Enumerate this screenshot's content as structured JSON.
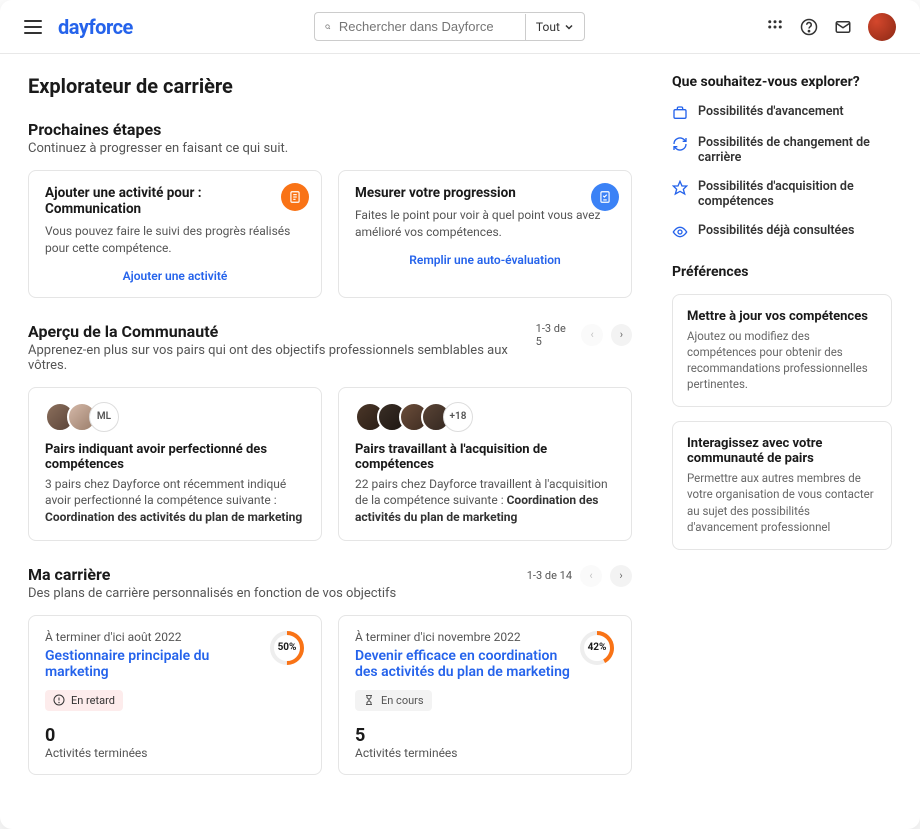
{
  "header": {
    "logo": "dayforce",
    "search_placeholder": "Rechercher dans Dayforce",
    "search_filter": "Tout"
  },
  "page_title": "Explorateur de carrière",
  "next_steps": {
    "heading": "Prochaines étapes",
    "subtitle": "Continuez à progresser en faisant ce qui suit.",
    "cards": [
      {
        "title": "Ajouter une activité pour : Communication",
        "desc": "Vous pouvez faire le suivi des progrès réalisés pour cette compétence.",
        "link": "Ajouter une activité"
      },
      {
        "title": "Mesurer votre progression",
        "desc": "Faites le point pour voir à quel point vous avez amélioré vos compétences.",
        "link": "Remplir une auto-évaluation"
      }
    ]
  },
  "community": {
    "heading": "Aperçu de la Communauté",
    "subtitle": "Apprenez-en plus sur vos pairs qui ont des objectifs professionnels semblables aux vôtres.",
    "pager": "1-3 de 5",
    "cards": [
      {
        "extra_label": "ML",
        "title": "Pairs indiquant avoir perfectionné des compétences",
        "desc_prefix": "3 pairs chez Dayforce ont récemment indiqué avoir perfectionné la compétence suivante : ",
        "desc_bold": "Coordination des activités du plan de marketing"
      },
      {
        "extra_label": "+18",
        "title": "Pairs travaillant à l'acquisition de compétences",
        "desc_prefix": "22 pairs chez Dayforce travaillent à l'acquisition de la compétence suivante : ",
        "desc_bold": "Coordination des activités du plan de marketing"
      }
    ]
  },
  "career": {
    "heading": "Ma carrière",
    "subtitle": "Des plans de carrière personnalisés en fonction de vos objectifs",
    "pager": "1-3 de 14",
    "cards": [
      {
        "due": "À terminer d'ici août 2022",
        "title": "Gestionnaire principale du marketing",
        "progress": 50,
        "progress_label": "50%",
        "badge": "En retard",
        "badge_type": "late",
        "count": "0",
        "count_label": "Activités terminées"
      },
      {
        "due": "À terminer d'ici novembre 2022",
        "title": "Devenir efficace en coordination des activités du plan de marketing",
        "progress": 42,
        "progress_label": "42%",
        "badge": "En cours",
        "badge_type": "progress",
        "count": "5",
        "count_label": "Activités terminées"
      }
    ]
  },
  "sidebar": {
    "explore_heading": "Que souhaitez-vous explorer?",
    "explore_items": [
      "Possibilités d'avancement",
      "Possibilités de changement de carrière",
      "Possibilités d'acquisition de compétences",
      "Possibilités déjà consultées"
    ],
    "prefs_heading": "Préférences",
    "pref_cards": [
      {
        "title": "Mettre à jour vos compétences",
        "desc": "Ajoutez ou modifiez des compétences pour obtenir des recommandations professionnelles pertinentes."
      },
      {
        "title": "Interagissez avec votre communauté de pairs",
        "desc": "Permettre aux autres membres de votre organisation de vous contacter au sujet des possibilités d'avancement professionnel"
      }
    ]
  }
}
